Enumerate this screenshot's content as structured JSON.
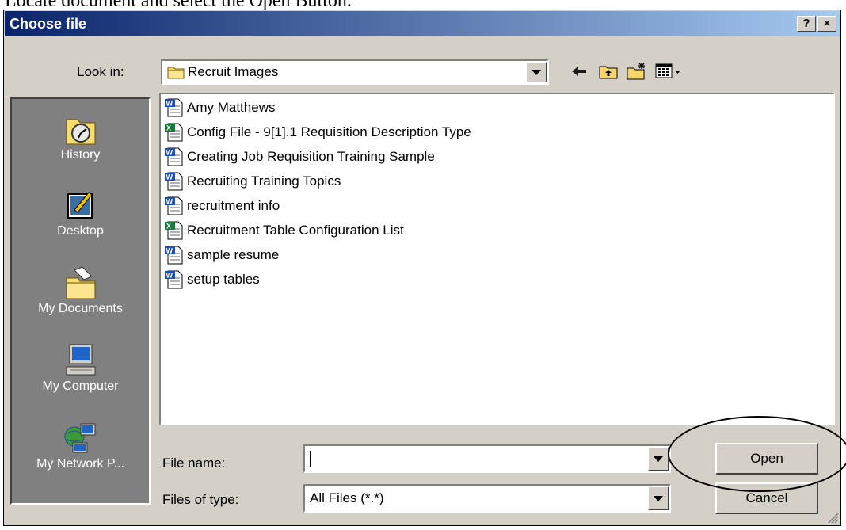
{
  "caption": "Locate document and select the Open Button.",
  "dialog": {
    "title": "Choose file",
    "help_label": "?",
    "close_label": "×"
  },
  "look_in": {
    "label": "Look in:",
    "value": "Recruit Images"
  },
  "places": [
    {
      "label": "History",
      "icon": "history-icon"
    },
    {
      "label": "Desktop",
      "icon": "desktop-icon"
    },
    {
      "label": "My Documents",
      "icon": "my-documents-icon"
    },
    {
      "label": "My Computer",
      "icon": "my-computer-icon"
    },
    {
      "label": "My Network P...",
      "icon": "my-network-places-icon"
    }
  ],
  "files": [
    {
      "name": "Amy Matthews",
      "icon": "word-document-icon"
    },
    {
      "name": "Config File - 9[1].1 Requisition Description Type",
      "icon": "excel-document-icon"
    },
    {
      "name": "Creating Job Requisition Training Sample",
      "icon": "word-document-icon"
    },
    {
      "name": "Recruiting Training Topics",
      "icon": "word-document-icon"
    },
    {
      "name": "recruitment info",
      "icon": "word-document-icon"
    },
    {
      "name": "Recruitment Table Configuration List",
      "icon": "excel-document-icon"
    },
    {
      "name": "sample resume",
      "icon": "word-document-icon"
    },
    {
      "name": "setup tables",
      "icon": "word-document-icon"
    }
  ],
  "file_name": {
    "label": "File name:",
    "value": ""
  },
  "file_type": {
    "label": "Files of type:",
    "value": "All Files (*.*)"
  },
  "buttons": {
    "open": "Open",
    "cancel": "Cancel"
  },
  "colors": {
    "title_start": "#0a246a",
    "title_end": "#a6caf0",
    "face": "#d4d0c8",
    "places_bg": "#808080"
  }
}
